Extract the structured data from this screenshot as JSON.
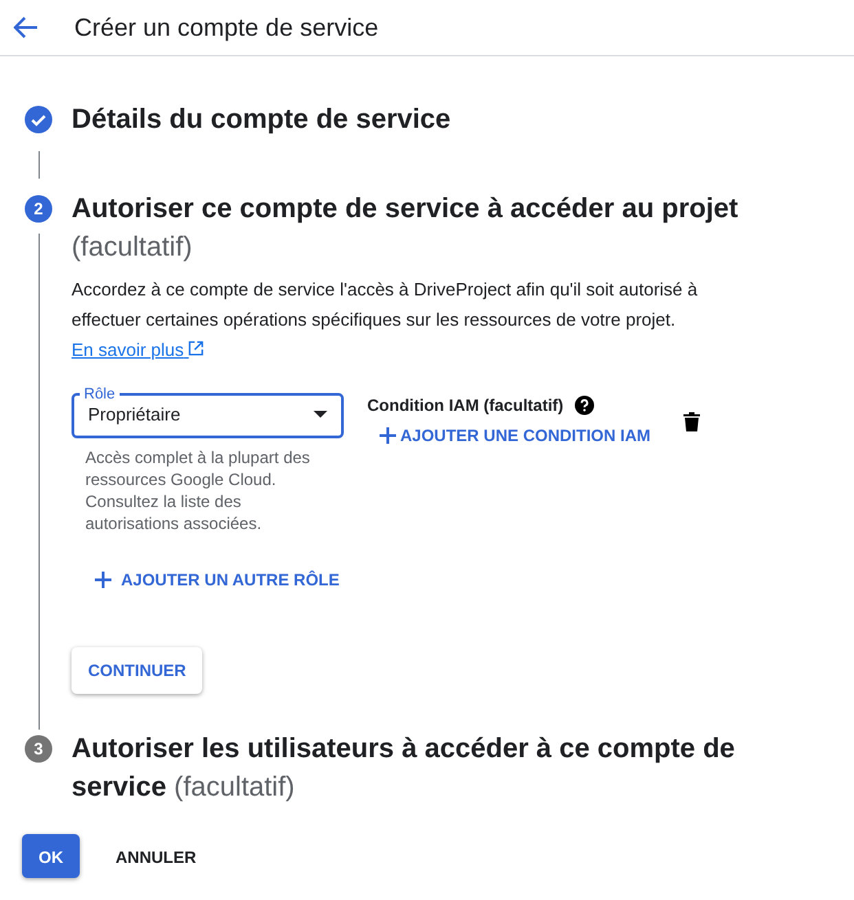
{
  "header": {
    "title": "Créer un compte de service"
  },
  "steps": [
    {
      "kind": "done",
      "title": "Détails du compte de service"
    },
    {
      "kind": "active",
      "number": "2",
      "title": "Autoriser ce compte de service à accéder au projet",
      "optional": "(facultatif)"
    },
    {
      "kind": "pending",
      "number": "3",
      "title": "Autoriser les utilisateurs à accéder à ce compte de service",
      "optional": "(facultatif)"
    }
  ],
  "grant": {
    "description": "Accordez à ce compte de service l'accès à DriveProject afin qu'il soit autorisé à effectuer certaines opérations spécifiques sur les ressources de votre projet.",
    "link": "En savoir plus",
    "role": {
      "label": "Rôle",
      "value": "Propriétaire",
      "help": "Accès complet à la plupart des ressources Google Cloud. Consultez la liste des autorisations associées."
    },
    "condition": {
      "label": "Condition IAM (facultatif)",
      "add": "AJOUTER UNE CONDITION IAM"
    },
    "add_role": "AJOUTER UN AUTRE RÔLE",
    "continue": "CONTINUER"
  },
  "buttons": [
    {
      "kind": "primary",
      "label": "OK"
    },
    {
      "kind": "text",
      "label": "ANNULER"
    }
  ]
}
